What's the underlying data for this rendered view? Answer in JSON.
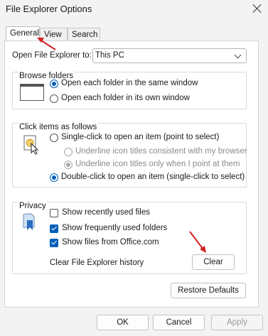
{
  "window": {
    "title": "File Explorer Options"
  },
  "tabs": [
    {
      "label": "General"
    },
    {
      "label": "View"
    },
    {
      "label": "Search"
    }
  ],
  "open_in": {
    "label": "Open File Explorer to:",
    "value": "This PC"
  },
  "browse": {
    "title": "Browse folders",
    "options": [
      "Open each folder in the same window",
      "Open each folder in its own window"
    ]
  },
  "click": {
    "title": "Click items as follows",
    "single": "Single-click to open an item (point to select)",
    "sub1": "Underline icon titles consistent with my browser",
    "sub2": "Underline icon titles only when I point at them",
    "double": "Double-click to open an item (single-click to select)"
  },
  "privacy": {
    "title": "Privacy",
    "checks": [
      "Show recently used files",
      "Show frequently used folders",
      "Show files from Office.com"
    ],
    "clear_label": "Clear File Explorer history",
    "clear_button": "Clear"
  },
  "buttons": {
    "restore": "Restore Defaults",
    "ok": "OK",
    "cancel": "Cancel",
    "apply": "Apply"
  },
  "colors": {
    "accent": "#005fb8",
    "annotation_arrow": "#d32020"
  }
}
